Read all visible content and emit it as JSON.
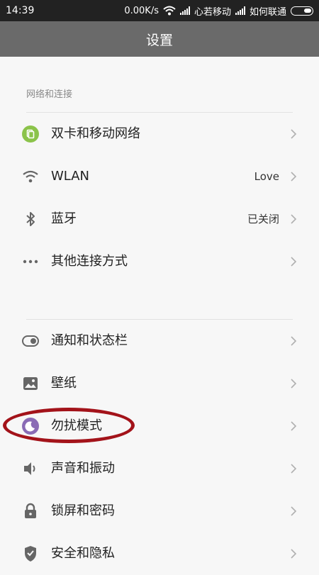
{
  "status_bar": {
    "time": "14:39",
    "speed": "0.00K/s",
    "carrier1": "心若移动",
    "carrier2": "如何联通"
  },
  "title": "设置",
  "section1": {
    "header": "网络和连接",
    "items": [
      {
        "label": "双卡和移动网络",
        "value": "",
        "icon": "sim-card-icon"
      },
      {
        "label": "WLAN",
        "value": "Love",
        "icon": "wifi-icon"
      },
      {
        "label": "蓝牙",
        "value": "已关闭",
        "icon": "bluetooth-icon"
      },
      {
        "label": "其他连接方式",
        "value": "",
        "icon": "more-dots-icon"
      }
    ]
  },
  "section2": {
    "items": [
      {
        "label": "通知和状态栏",
        "value": "",
        "icon": "toggle-icon"
      },
      {
        "label": "壁纸",
        "value": "",
        "icon": "image-icon"
      },
      {
        "label": "勿扰模式",
        "value": "",
        "icon": "moon-icon"
      },
      {
        "label": "声音和振动",
        "value": "",
        "icon": "speaker-icon"
      },
      {
        "label": "锁屏和密码",
        "value": "",
        "icon": "lock-icon"
      },
      {
        "label": "安全和隐私",
        "value": "",
        "icon": "shield-icon"
      }
    ]
  },
  "colors": {
    "title_bar": "#6a6a6a",
    "sim_icon": "#8bc34a",
    "moon_icon": "#8a6bb5",
    "highlight": "#a3131a"
  }
}
